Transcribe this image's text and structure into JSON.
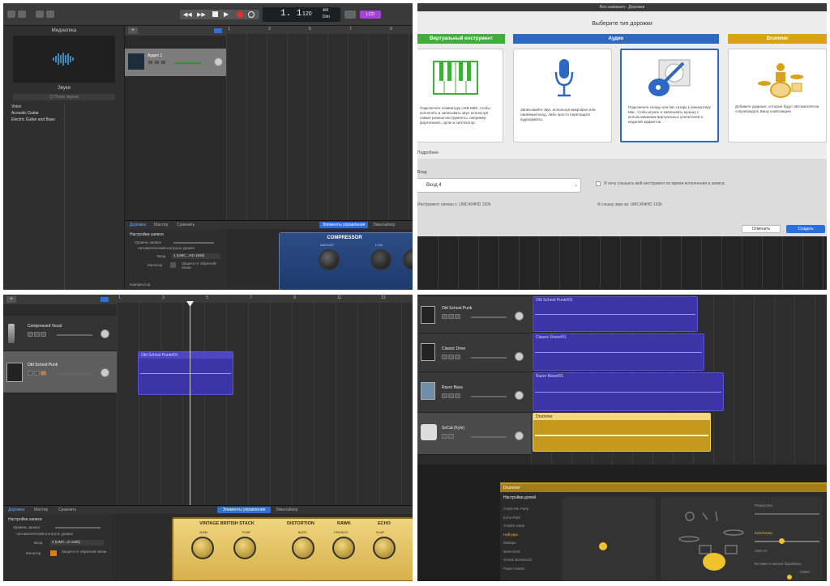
{
  "q1": {
    "transport": {
      "position": "1. 1",
      "tempo": "120",
      "signature": "4/4",
      "key": "Dim",
      "lcd_label": "LCD"
    },
    "library": {
      "title": "Медиатека",
      "sounds_label": "Звуки",
      "search_placeholder": "Q Поиск звуков",
      "categories": [
        "Voice",
        "Acoustic Guitar",
        "Electric Guitar and Bass"
      ]
    },
    "track": {
      "name": "Аудио 1"
    },
    "ruler": [
      "1",
      "3",
      "5",
      "7",
      "9"
    ],
    "bottom_tabs": {
      "track": "Дорожка",
      "master": "Мастер",
      "compare": "Сравнить",
      "controls": "Элементы управления",
      "eq": "Эквалайзер"
    },
    "record_settings": {
      "title": "Настройки записи",
      "level": "Уровень записи",
      "auto_level": "Автоматический контроль уровня",
      "input_label": "Вход",
      "input_value": "1 (UMC...HD 192k)",
      "monitor_label": "Монитор",
      "feedback": "Защита от обратной связи",
      "compressor_label": "Компрессор"
    },
    "compressor": {
      "title": "COMPRESSOR",
      "amount": "AMOUNT",
      "low": "LOW"
    }
  },
  "q2": {
    "window_title": "Без названия - Дорожки",
    "dialog_title": "Выберите тип дорожки",
    "types": [
      {
        "label": "Виртуальный инструмент",
        "color": "#3fae3a",
        "desc": "Подключите клавиатуру USB MIDI, чтобы исполнять и записывать звук, используя самые разные инструменты, например фортепиано, орган и синтезатор."
      },
      {
        "label": "Аудио",
        "color": "#2f68c0",
        "desc": "Записывайте звук, используя микрофон или линейный вход, либо просто перетащите аудиофайлы."
      },
      {
        "label": "",
        "color": "#2f68c0",
        "desc": "Подключите гитару или бас-гитару к компьютеру Mac, чтобы играть и записывать музыку с использованием виртуальных усилителей и педалей эффектов."
      },
      {
        "label": "Drummer",
        "color": "#d9a21a",
        "desc": "Добавьте ударные, которые будут автоматически сопровождать Вашу композицию."
      }
    ],
    "details_label": "Подробнее",
    "input_label": "Вход",
    "input_value": "Вход 4",
    "hear_checkbox": "Я хочу слышать мой инструмент во время исполнения и записи.",
    "connected": "Инструмент связан с: UMC404HD 192k",
    "hear_via": "Я слышу звук из: UMC404HD 192k",
    "cancel": "Отменить",
    "create": "Создать"
  },
  "q3": {
    "tracks": [
      {
        "name": "Compressed Vocal"
      },
      {
        "name": "Old School Punk"
      }
    ],
    "ruler": [
      "1",
      "3",
      "5",
      "7",
      "9",
      "11",
      "13"
    ],
    "region": {
      "name": "Old School Punk#01"
    },
    "bottom_tabs": {
      "track": "Дорожка",
      "master": "Мастер",
      "compare": "Сравнить",
      "controls": "Элементы управления",
      "eq": "Эквалайзер"
    },
    "record_settings": {
      "title": "Настройки записи",
      "level": "Уровень записи",
      "auto_level": "Автоматический контроль уровня",
      "input_label": "Вход",
      "input_value": "4 (UMC...D 192k)",
      "monitor_label": "Монитор",
      "feedback": "Защита от обратной связи"
    },
    "amp": {
      "name": "VINTAGE BRITISH STACK",
      "gain": "GAIN",
      "tone": "TONE",
      "distortion": "DISTORTION",
      "raw": "RAWK",
      "echo": "ECHO",
      "buzz": "BUZZ",
      "crunch": "CRUNCH",
      "slap": "SLAP"
    }
  },
  "q4": {
    "tracks": [
      {
        "name": "Old School Punk",
        "region": "Old School Punk#01"
      },
      {
        "name": "Classic Drive",
        "region": "Classic Drive#01"
      },
      {
        "name": "Razor Bass",
        "region": "Razor Bass#01"
      },
      {
        "name": "SoCal (Kyle)",
        "region": "Drummer"
      }
    ],
    "drummer_editor": {
      "title": "Drummer",
      "presets_header": "Настройки долей",
      "presets": [
        "Crash the Party",
        "Echo Park",
        "Golden State",
        "Half-pipe",
        "Mixtape",
        "New Kicks",
        "Ocean Boulevard",
        "Paper Hearts"
      ],
      "selected_index": 3,
      "percussion": "Перкуссия",
      "kick_snare": "Kick/Snare",
      "hihat": "Хай-хэт",
      "fills": "Вставки и малые барабаны",
      "swing": "Свинг"
    }
  }
}
